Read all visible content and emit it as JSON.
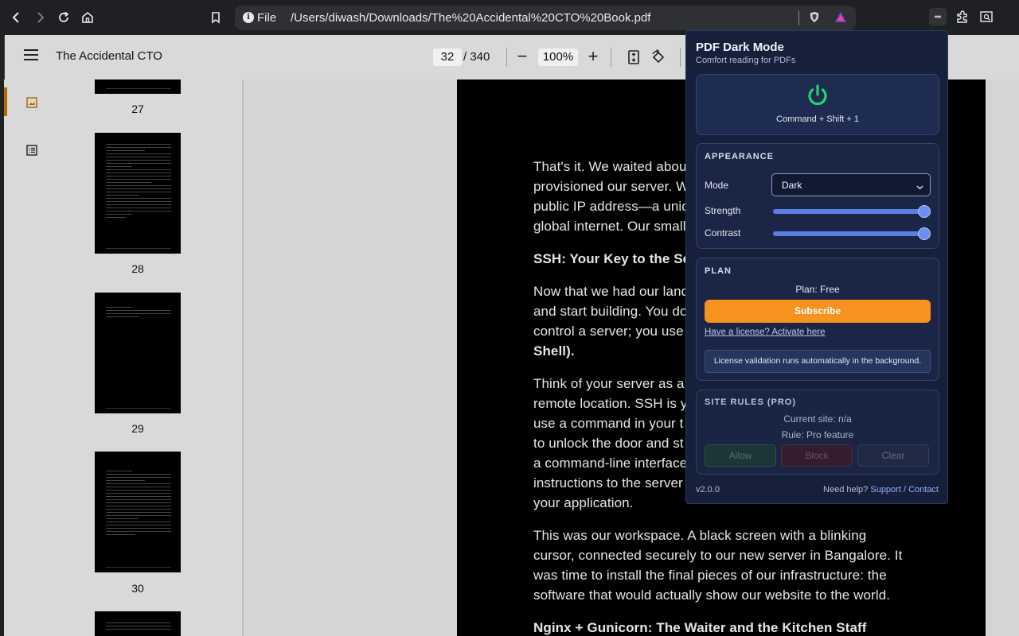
{
  "browser": {
    "scheme_label": "File",
    "url": "/Users/diwash/Downloads/The%20Accidental%20CTO%20Book.pdf",
    "icons": [
      "back-icon",
      "forward-icon",
      "reload-icon",
      "home-icon",
      "bookmark-icon",
      "info-icon",
      "brave-shield-icon",
      "brave-rewards-icon",
      "pdf-dark-mode-extension-icon",
      "extensions-icon",
      "sidebar-search-icon"
    ]
  },
  "viewer": {
    "title": "The Accidental CTO",
    "page_current": "32",
    "page_total": "/ 340",
    "zoom": "100%",
    "zoom_out_symbol": "−",
    "zoom_in_symbol": "+",
    "accent_color": "#b06a00"
  },
  "thumbnails": [
    {
      "label": "27"
    },
    {
      "label": "28"
    },
    {
      "label": "29"
    },
    {
      "label": "30"
    }
  ],
  "page_text": {
    "lines": [
      {
        "text": "That's it. We waited abou",
        "bold": false
      },
      {
        "text": "provisioned our server. W",
        "bold": false
      },
      {
        "text": "public IP address—a uniq",
        "bold": false
      },
      {
        "text": "global internet. Our small",
        "bold": false
      },
      {
        "text": "SSH: Your Key to the Se",
        "bold": true
      },
      {
        "text": "Now that we had our land",
        "bold": false
      },
      {
        "text": "and start building. You do",
        "bold": false
      },
      {
        "text": "control a server; you use",
        "bold": false
      },
      {
        "text": "Shell).",
        "bold": false
      },
      {
        "text": "Think of your server as a",
        "bold": false
      },
      {
        "text": "remote location. SSH is y",
        "bold": false
      },
      {
        "text": "use a command in your t",
        "bold": false
      },
      {
        "text": "to unlock the door and st",
        "bold": false
      },
      {
        "text": "a command-line interface",
        "bold": false
      },
      {
        "text": "instructions to the server",
        "bold": false
      },
      {
        "text": "your application.",
        "bold": false
      },
      {
        "text": "This was our workspace. A black screen with a blinking",
        "bold": false
      },
      {
        "text": "cursor, connected securely to our new server in Bangalore. It",
        "bold": false
      },
      {
        "text": "was time to install the final pieces of our infrastructure: the",
        "bold": false
      },
      {
        "text": "software that would actually show our website to the world.",
        "bold": false
      },
      {
        "text": "Nginx + Gunicorn: The Waiter and the Kitchen Staff",
        "bold": true
      }
    ]
  },
  "popup": {
    "title": "PDF Dark Mode",
    "subtitle": "Comfort reading for PDFs",
    "power_color": "#22d36b",
    "shortcut": "Command + Shift + 1",
    "appearance": {
      "heading": "APPEARANCE",
      "mode_label": "Mode",
      "mode_value": "Dark",
      "strength_label": "Strength",
      "strength_value": 1.0,
      "contrast_label": "Contrast",
      "contrast_value": 1.0
    },
    "plan": {
      "heading": "PLAN",
      "plan_text": "Plan: Free",
      "subscribe_label": "Subscribe",
      "license_link": "Have a license? Activate here",
      "license_note": "License validation runs automatically in the background."
    },
    "site_rules": {
      "heading": "SITE RULES (PRO)",
      "current_site": "Current site: n/a",
      "rule": "Rule: Pro feature",
      "allow_label": "Allow",
      "block_label": "Block",
      "clear_label": "Clear"
    },
    "version": "v2.0.0",
    "help_prefix": "Need help?",
    "support_link": "Support",
    "link_sep": "/",
    "contact_link": "Contact"
  }
}
